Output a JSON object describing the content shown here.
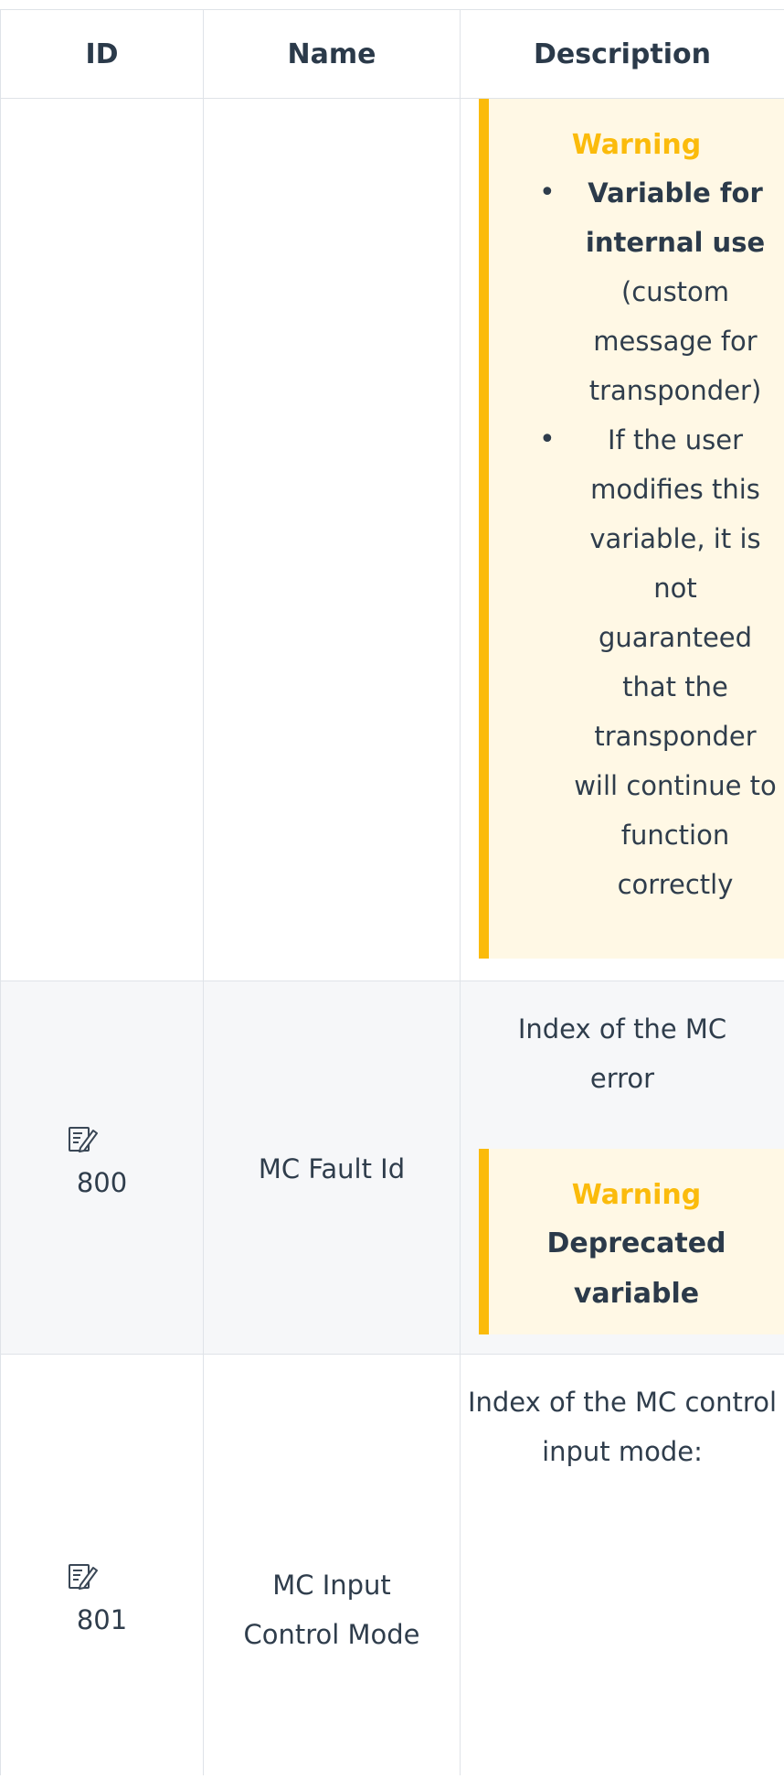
{
  "table": {
    "headers": {
      "id": "ID",
      "name": "Name",
      "description": "Description"
    },
    "rows": [
      {
        "id": "",
        "name": "",
        "description": {
          "warning_title": "Warning",
          "items": [
            {
              "bold": "Variable for internal use",
              "normal": " (custom message for transponder)"
            },
            {
              "normal": "If the user modifies this variable, it is not guaranteed that the transponder will continue to function correctly"
            }
          ]
        }
      },
      {
        "id": "800",
        "icon": "edit-icon",
        "name": "MC Fault Id",
        "description": {
          "text": "Index of the MC error",
          "warning_title": "Warning",
          "warning_bold": "Deprecated variable"
        }
      },
      {
        "id": "801",
        "icon": "edit-icon",
        "name": "MC Input Control Mode",
        "description": {
          "text": "Index of the MC control input mode:"
        }
      }
    ]
  },
  "colors": {
    "warning_accent": "#fbbb0b",
    "warning_bg": "#fff8e5",
    "text": "#2f3d4c",
    "alt_row_bg": "#f6f7f9",
    "border": "#dfe3e8"
  }
}
